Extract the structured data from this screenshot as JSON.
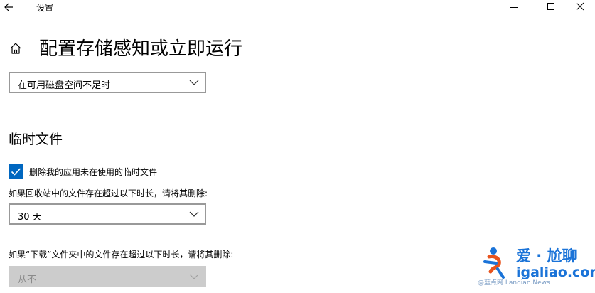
{
  "window": {
    "title": "设置",
    "controls": [
      "minimize-icon",
      "maximize-icon",
      "close-icon"
    ]
  },
  "page": {
    "title": "配置存储感知或立即运行"
  },
  "run_dropdown": {
    "selected": "在可用磁盘空间不足时"
  },
  "temp_files": {
    "heading": "临时文件",
    "delete_checkbox": {
      "label": "删除我的应用未在使用的临时文件",
      "checked": true
    },
    "recycle_bin_label": "如果回收站中的文件存在超过以下时长，请将其删除:",
    "recycle_bin_dropdown": {
      "selected": "30 天"
    },
    "downloads_label": "如果“下载”文件夹中的文件存在超过以下时长，请将其删除:",
    "downloads_dropdown": {
      "selected": "从不",
      "disabled": true
    }
  },
  "watermark": {
    "brand": "爱 · 尬聊",
    "domain": "igaliao.com",
    "credit": "@蓝点网 Landian.News"
  },
  "colors": {
    "accent": "#0067c0",
    "border": "#999999",
    "disabled_fill": "#cccccc",
    "watermark": "#1a73d8"
  }
}
